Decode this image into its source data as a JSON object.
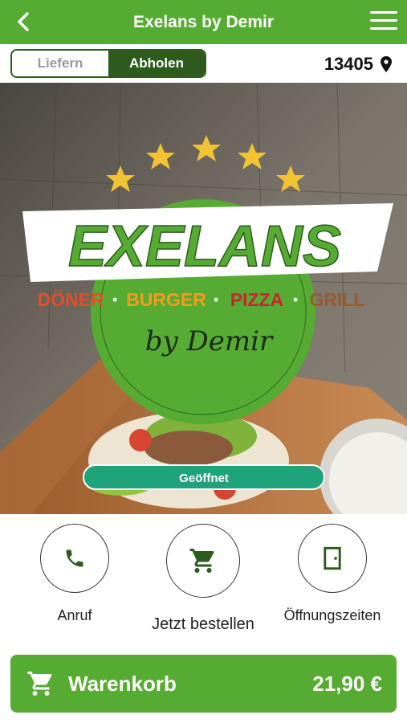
{
  "header": {
    "title": "Exelans by Demir",
    "back_icon": "chevron-left-icon",
    "menu_icon": "hamburger-menu-icon"
  },
  "mode": {
    "options": [
      "Liefern",
      "Abholen"
    ],
    "selected": "Abholen"
  },
  "location": {
    "zip": "13405",
    "icon": "map-pin-icon"
  },
  "hero": {
    "logo_text": "EXELANS",
    "tagline": [
      "DÖNER",
      "BURGER",
      "PIZZA",
      "GRILL"
    ],
    "subtitle": "by Demir",
    "stars": 5,
    "status": "Geöffnet"
  },
  "actions": [
    {
      "label": "Anruf",
      "icon": "phone-icon"
    },
    {
      "label": "Jetzt bestellen",
      "icon": "shopping-cart-icon"
    },
    {
      "label": "Öffnungszeiten",
      "icon": "door-icon"
    }
  ],
  "cart": {
    "label": "Warenkorb",
    "total": "21,90 €",
    "icon": "shopping-cart-icon"
  },
  "colors": {
    "brand_green": "#56ac32",
    "dark_green": "#2f5a1e",
    "status_teal": "#1fa37a"
  }
}
